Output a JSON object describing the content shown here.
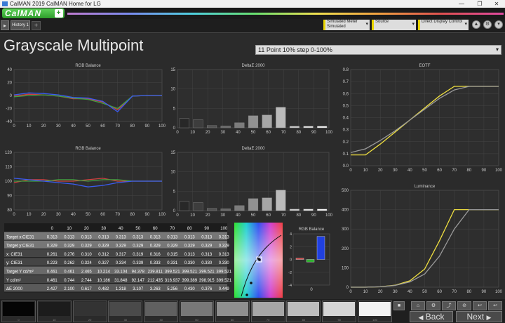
{
  "window": {
    "title": "CalMAN 2019 CalMAN Home for LG",
    "minimize_glyph": "—",
    "maximize_glyph": "❐",
    "close_glyph": "✕"
  },
  "brand": {
    "name": "CalMAN",
    "plus_glyph": "+"
  },
  "tabs": {
    "nav_glyph": "▸",
    "history_label": "History 1",
    "add_glyph": "+"
  },
  "toolbar": {
    "meter": {
      "line1": "Simulated Meter",
      "line2": "Simulated"
    },
    "source": {
      "label": "Source"
    },
    "display": {
      "label": "Direct Display Control"
    },
    "dropdown_glyph": "▾",
    "round_buttons": [
      "▲",
      "⚙",
      "▾"
    ]
  },
  "page": {
    "title": "Grayscale Multipoint",
    "sequence": "11 Point 10% step 0-100%"
  },
  "charts": {
    "rgb_balance_top": {
      "title": "RGB Balance"
    },
    "deltae_top": {
      "title": "DeltaE 2000"
    },
    "eotf": {
      "title": "EOTF"
    },
    "rgb_balance_bottom": {
      "title": "RGB Balance"
    },
    "deltae_bottom": {
      "title": "DeltaE 2000"
    },
    "luminance": {
      "title": "Luminance"
    },
    "rgb_balance_small": {
      "title": "RGB Balance"
    }
  },
  "chart_data": [
    {
      "id": "rgb_balance_top",
      "type": "line",
      "title": "RGB Balance",
      "x": [
        0,
        10,
        20,
        30,
        40,
        50,
        60,
        70,
        80,
        90,
        100
      ],
      "ylim": [
        -40,
        40
      ],
      "yticks": [
        40,
        20,
        0,
        -20,
        -40
      ],
      "series": [
        {
          "color": "#d04040",
          "values": [
            -1,
            2,
            1,
            -1,
            -5,
            -5,
            -10,
            -22,
            -1,
            0,
            0
          ]
        },
        {
          "color": "#40a040",
          "values": [
            -2,
            0,
            1,
            -1,
            -4,
            -6,
            -12,
            -20,
            -1,
            0,
            0
          ]
        },
        {
          "color": "#3a5cf0",
          "values": [
            1,
            4,
            3,
            1,
            -3,
            -4,
            -9,
            -25,
            -1,
            0,
            0
          ]
        }
      ]
    },
    {
      "id": "deltae_top",
      "type": "bar",
      "title": "DeltaE 2000",
      "x": [
        0,
        10,
        20,
        30,
        40,
        50,
        60,
        70,
        80,
        90,
        100
      ],
      "values": [
        2.4,
        2.1,
        0.6,
        0.5,
        1.3,
        3.1,
        3.3,
        5.3,
        0.4,
        0.4,
        0.4
      ],
      "ylim": [
        0,
        15
      ],
      "yticks": [
        15,
        10,
        5,
        0
      ]
    },
    {
      "id": "eotf",
      "type": "line",
      "title": "EOTF",
      "x": [
        0,
        10,
        20,
        30,
        40,
        50,
        60,
        70,
        80,
        90,
        100
      ],
      "ylim": [
        0,
        0.8
      ],
      "yticks": [
        0.8,
        0.7,
        0.6,
        0.5,
        0.4,
        0.3,
        0.2,
        0.1,
        0
      ],
      "series": [
        {
          "color": "#f0e040",
          "values": [
            0.09,
            0.09,
            0.18,
            0.28,
            0.38,
            0.48,
            0.58,
            0.66,
            0.66,
            0.66,
            0.66
          ]
        },
        {
          "color": "#9a9a9a",
          "values": [
            0.11,
            0.14,
            0.21,
            0.29,
            0.38,
            0.47,
            0.56,
            0.63,
            0.66,
            0.66,
            0.66
          ]
        }
      ]
    },
    {
      "id": "rgb_balance_bottom",
      "type": "line",
      "title": "RGB Balance",
      "x": [
        0,
        10,
        20,
        30,
        40,
        50,
        60,
        70,
        80,
        90,
        100
      ],
      "ylim": [
        80,
        120
      ],
      "yticks": [
        120,
        110,
        100,
        90,
        80
      ],
      "series": [
        {
          "color": "#d04040",
          "values": [
            99,
            101,
            101,
            100,
            100,
            101,
            102,
            100,
            100,
            100,
            100
          ]
        },
        {
          "color": "#40a040",
          "values": [
            100,
            100,
            100,
            101,
            101,
            100,
            101,
            101,
            100,
            100,
            100
          ]
        },
        {
          "color": "#3a5cf0",
          "values": [
            102,
            101,
            100,
            99,
            98,
            96,
            97,
            99,
            100,
            100,
            100
          ]
        }
      ]
    },
    {
      "id": "deltae_bottom",
      "type": "bar",
      "title": "DeltaE 2000",
      "x": [
        0,
        10,
        20,
        30,
        40,
        50,
        60,
        70,
        80,
        90,
        100
      ],
      "values": [
        2.4,
        2.1,
        0.6,
        0.5,
        1.3,
        3.1,
        3.3,
        5.3,
        0.4,
        0.4,
        0.4
      ],
      "ylim": [
        0,
        15
      ],
      "yticks": [
        15,
        10,
        5,
        0
      ]
    },
    {
      "id": "luminance",
      "type": "line",
      "title": "Luminance",
      "x": [
        0,
        10,
        20,
        30,
        40,
        50,
        60,
        70,
        80,
        90,
        100
      ],
      "ylim": [
        0,
        500
      ],
      "yticks": [
        500,
        400,
        300,
        200,
        100,
        0
      ],
      "series": [
        {
          "color": "#f0e040",
          "values": [
            0,
            0,
            2,
            10,
            33,
            94,
            240,
            400,
            400,
            400,
            400
          ]
        },
        {
          "color": "#9a9a9a",
          "values": [
            0,
            0,
            2,
            9,
            27,
            68,
            160,
            300,
            400,
            400,
            400
          ]
        }
      ]
    },
    {
      "id": "rgb_balance_small",
      "type": "bar",
      "title": "RGB Balance",
      "categories": [
        "0"
      ],
      "series": [
        {
          "color": "#e04040",
          "values": [
            0.2
          ]
        },
        {
          "color": "#30b030",
          "values": [
            -0.4
          ]
        },
        {
          "color": "#2040e0",
          "values": [
            3.6
          ]
        }
      ],
      "ylim": [
        -4,
        4
      ],
      "yticks": [
        4,
        2,
        0,
        -2,
        -4
      ]
    }
  ],
  "table": {
    "headers": [
      "",
      "0",
      "10",
      "20",
      "30",
      "40",
      "50",
      "60",
      "70",
      "80",
      "90",
      "100"
    ],
    "rows": [
      [
        "Target x:CIE31",
        "0.313",
        "0.313",
        "0.313",
        "0.313",
        "0.313",
        "0.313",
        "0.313",
        "0.313",
        "0.313",
        "0.313",
        "0.313"
      ],
      [
        "Target y:CIE31",
        "0.329",
        "0.329",
        "0.329",
        "0.329",
        "0.329",
        "0.329",
        "0.329",
        "0.329",
        "0.329",
        "0.329",
        "0.329"
      ],
      [
        "x: CIE31",
        "0.261",
        "0.276",
        "0.310",
        "0.312",
        "0.317",
        "0.319",
        "0.316",
        "0.315",
        "0.313",
        "0.313",
        "0.313"
      ],
      [
        "y: CIE31",
        "0.223",
        "0.262",
        "0.324",
        "0.327",
        "0.334",
        "0.339",
        "0.333",
        "0.331",
        "0.330",
        "0.330",
        "0.330"
      ],
      [
        "Target Y cd/m²",
        "0.461",
        "0.461",
        "2.465",
        "10.214",
        "33.104",
        "94.378",
        "239.811",
        "399.521",
        "399.521",
        "399.521",
        "399.521"
      ],
      [
        "Y cd/m²",
        "0.461",
        "0.744",
        "2.744",
        "10.186",
        "31.848",
        "92.147",
        "212.435",
        "316.937",
        "399.389",
        "398.915",
        "399.521"
      ],
      [
        "ΔE 2000",
        "2.427",
        "2.100",
        "0.617",
        "0.482",
        "1.318",
        "3.107",
        "3.263",
        "5.256",
        "0.430",
        "0.376",
        "0.449"
      ]
    ]
  },
  "swatches": {
    "labels": [
      "0",
      "10",
      "20",
      "30",
      "40",
      "50",
      "60",
      "70",
      "80",
      "90",
      "100"
    ],
    "colors": [
      "#050505",
      "#1c1c1c",
      "#333333",
      "#4a4a4a",
      "#606060",
      "#787878",
      "#8f8f8f",
      "#a6a6a6",
      "#bdbdbd",
      "#d5d5d5",
      "#f4f4f4"
    ]
  },
  "controls": {
    "stop_glyph": "■",
    "icons": [
      "⌂",
      "⚙",
      "⤴",
      "⊘",
      "↩"
    ],
    "back_label": "Back",
    "next_label": "Next",
    "back_glyph": "◀",
    "next_glyph": "▶"
  },
  "colors": {
    "accent_green": "#2e9c2b",
    "highlight_yellow": "#f0e040"
  }
}
